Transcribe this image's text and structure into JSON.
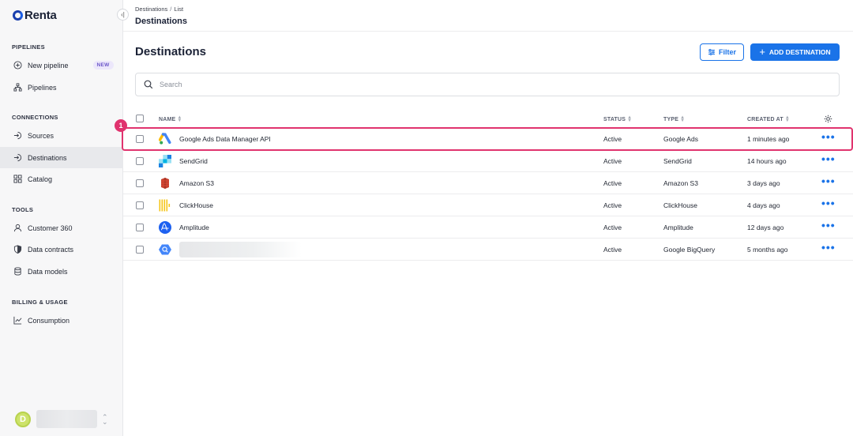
{
  "app": {
    "logo_text": "Renta",
    "collapse_icon": "collapse-left-icon"
  },
  "sidebar": {
    "sections": [
      {
        "title": "PIPELINES"
      },
      {
        "title": "CONNECTIONS"
      },
      {
        "title": "TOOLS"
      },
      {
        "title": "BILLING & USAGE"
      }
    ],
    "items": [
      {
        "label": "New pipeline",
        "icon": "plus-circle-icon",
        "badge": "NEW"
      },
      {
        "label": "Pipelines",
        "icon": "hierarchy-icon"
      },
      {
        "label": "Sources",
        "icon": "sign-in-icon"
      },
      {
        "label": "Destinations",
        "icon": "sign-out-icon",
        "active": true
      },
      {
        "label": "Catalog",
        "icon": "grid-icon"
      },
      {
        "label": "Customer 360",
        "icon": "user-icon"
      },
      {
        "label": "Data contracts",
        "icon": "shield-icon"
      },
      {
        "label": "Data models",
        "icon": "database-icon"
      },
      {
        "label": "Consumption",
        "icon": "chart-line-icon"
      }
    ],
    "user": {
      "avatar_letter": "D",
      "avatar_color": "#cde36a"
    }
  },
  "header": {
    "breadcrumb": [
      "Destinations",
      "List"
    ],
    "title": "Destinations"
  },
  "main": {
    "title": "Destinations",
    "filter_label": "Filter",
    "add_label": "ADD DESTINATION",
    "search_placeholder": "Search",
    "columns": {
      "name": "NAME",
      "status": "STATUS",
      "type": "TYPE",
      "created_at": "CREATED AT"
    },
    "rows": [
      {
        "name": "Google Ads Data Manager API",
        "status": "Active",
        "type": "Google Ads",
        "created": "1 minutes ago",
        "icon": "google-ads-icon"
      },
      {
        "name": "SendGrid",
        "status": "Active",
        "type": "SendGrid",
        "created": "14 hours ago",
        "icon": "sendgrid-icon"
      },
      {
        "name": "Amazon S3",
        "status": "Active",
        "type": "Amazon S3",
        "created": "3 days ago",
        "icon": "amazon-s3-icon"
      },
      {
        "name": "ClickHouse",
        "status": "Active",
        "type": "ClickHouse",
        "created": "4 days ago",
        "icon": "clickhouse-icon"
      },
      {
        "name": "Amplitude",
        "status": "Active",
        "type": "Amplitude",
        "created": "12 days ago",
        "icon": "amplitude-icon"
      },
      {
        "name": "",
        "status": "Active",
        "type": "Google BigQuery",
        "created": "5 months ago",
        "icon": "bigquery-icon"
      }
    ]
  },
  "annotation": {
    "marker": "1",
    "color": "#e0336e"
  },
  "colors": {
    "accent": "#1a73e8",
    "highlight": "#e0336e"
  }
}
